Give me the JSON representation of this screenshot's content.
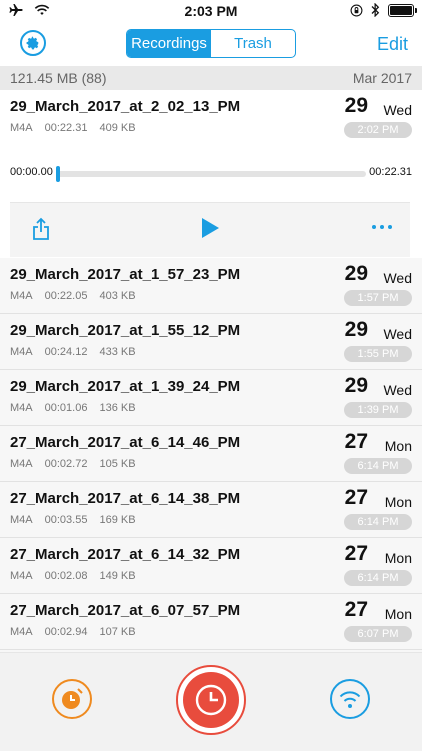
{
  "status_bar": {
    "time": "2:03 PM",
    "icons": [
      "airplane-icon",
      "wifi-icon",
      "orientation-lock-icon",
      "bluetooth-icon",
      "battery-icon"
    ]
  },
  "nav": {
    "settings_icon": "gear-icon",
    "tabs": [
      {
        "label": "Recordings",
        "active": true
      },
      {
        "label": "Trash",
        "active": false
      }
    ],
    "edit_label": "Edit"
  },
  "summary": {
    "total_size": "121.45 MB",
    "count": "(88)",
    "month": "Mar 2017"
  },
  "expanded": {
    "title": "29_March_2017_at_2_02_13_PM",
    "format": "M4A",
    "duration": "00:22.31",
    "size": "409 KB",
    "day": "29",
    "weekday": "Wed",
    "time": "2:02 PM",
    "position": "00:00.00",
    "total": "00:22.31",
    "progress": 0.0,
    "actions": {
      "share_icon": "share-icon",
      "play_icon": "play-icon",
      "more_icon": "more-icon"
    }
  },
  "recordings": [
    {
      "title": "29_March_2017_at_1_57_23_PM",
      "format": "M4A",
      "duration": "00:22.05",
      "size": "403 KB",
      "day": "29",
      "weekday": "Wed",
      "time": "1:57 PM"
    },
    {
      "title": "29_March_2017_at_1_55_12_PM",
      "format": "M4A",
      "duration": "00:24.12",
      "size": "433 KB",
      "day": "29",
      "weekday": "Wed",
      "time": "1:55 PM"
    },
    {
      "title": "29_March_2017_at_1_39_24_PM",
      "format": "M4A",
      "duration": "00:01.06",
      "size": "136 KB",
      "day": "29",
      "weekday": "Wed",
      "time": "1:39 PM"
    },
    {
      "title": "27_March_2017_at_6_14_46_PM",
      "format": "M4A",
      "duration": "00:02.72",
      "size": "105 KB",
      "day": "27",
      "weekday": "Mon",
      "time": "6:14 PM"
    },
    {
      "title": "27_March_2017_at_6_14_38_PM",
      "format": "M4A",
      "duration": "00:03.55",
      "size": "169 KB",
      "day": "27",
      "weekday": "Mon",
      "time": "6:14 PM"
    },
    {
      "title": "27_March_2017_at_6_14_32_PM",
      "format": "M4A",
      "duration": "00:02.08",
      "size": "149 KB",
      "day": "27",
      "weekday": "Mon",
      "time": "6:14 PM"
    },
    {
      "title": "27_March_2017_at_6_07_57_PM",
      "format": "M4A",
      "duration": "00:02.94",
      "size": "107 KB",
      "day": "27",
      "weekday": "Mon",
      "time": "6:07 PM"
    }
  ],
  "toolbar": {
    "timer_icon": "timer-icon",
    "record_icon": "record-clock-icon",
    "wifi_transfer_icon": "wifi-transfer-icon"
  },
  "colors": {
    "accent": "#1a9de1",
    "record": "#e84c3d",
    "timer": "#ef8a1f",
    "time_pill": "#d6d6d6"
  }
}
